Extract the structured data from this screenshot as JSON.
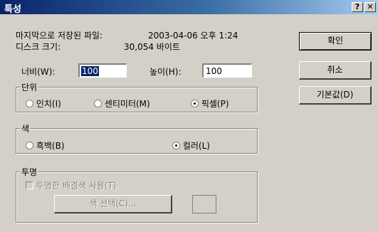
{
  "window": {
    "title": "특성",
    "help_label": "?",
    "close_label": "✕"
  },
  "info": {
    "last_saved_label": "마지막으로 저장된 파일:",
    "last_saved_value": "2003-04-06 오후 1:24",
    "disk_size_label": "디스크 크기:",
    "disk_size_value": "30,054 바이트"
  },
  "dimensions": {
    "width_label": "너비(W):",
    "width_value": "100",
    "height_label": "높이(H):",
    "height_value": "100"
  },
  "units": {
    "legend": "단위",
    "inch": "인치(I)",
    "cm": "센티미터(M)",
    "pixel": "픽셀(P)",
    "selected": "pixel"
  },
  "color": {
    "legend": "색",
    "bw": "흑백(B)",
    "color": "컬러(L)",
    "selected": "color"
  },
  "transparency": {
    "legend": "투명",
    "use_label": "투명한 배경색 사용(T)",
    "select_button": "색 선택(C)..."
  },
  "buttons": {
    "ok": "확인",
    "cancel": "취소",
    "default": "기본값(D)"
  }
}
